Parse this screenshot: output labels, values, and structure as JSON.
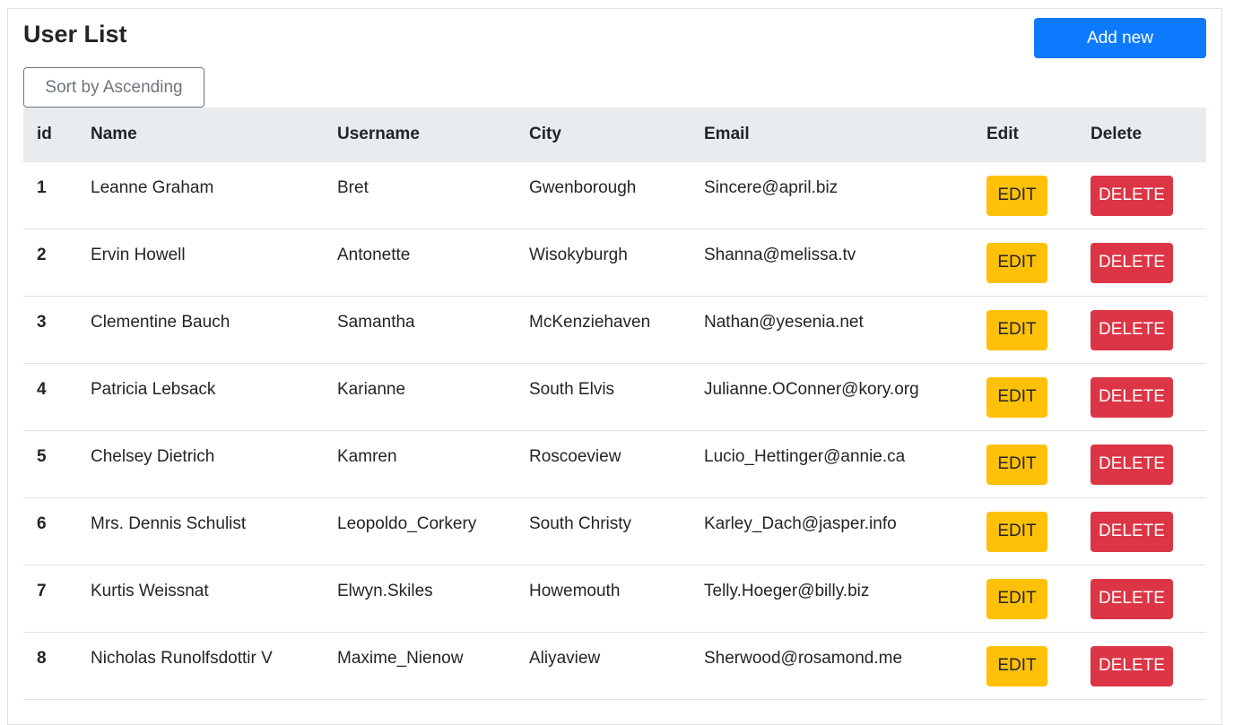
{
  "header": {
    "title": "User List",
    "add_label": "Add new",
    "sort_label": "Sort by Ascending"
  },
  "table": {
    "columns": [
      "id",
      "Name",
      "Username",
      "City",
      "Email",
      "Edit",
      "Delete"
    ],
    "edit_label": "EDIT",
    "delete_label": "DELETE",
    "rows": [
      {
        "id": "1",
        "name": "Leanne Graham",
        "username": "Bret",
        "city": "Gwenborough",
        "email": "Sincere@april.biz"
      },
      {
        "id": "2",
        "name": "Ervin Howell",
        "username": "Antonette",
        "city": "Wisokyburgh",
        "email": "Shanna@melissa.tv"
      },
      {
        "id": "3",
        "name": "Clementine Bauch",
        "username": "Samantha",
        "city": "McKenziehaven",
        "email": "Nathan@yesenia.net"
      },
      {
        "id": "4",
        "name": "Patricia Lebsack",
        "username": "Karianne",
        "city": "South Elvis",
        "email": "Julianne.OConner@kory.org"
      },
      {
        "id": "5",
        "name": "Chelsey Dietrich",
        "username": "Kamren",
        "city": "Roscoeview",
        "email": "Lucio_Hettinger@annie.ca"
      },
      {
        "id": "6",
        "name": "Mrs. Dennis Schulist",
        "username": "Leopoldo_Corkery",
        "city": "South Christy",
        "email": "Karley_Dach@jasper.info"
      },
      {
        "id": "7",
        "name": "Kurtis Weissnat",
        "username": "Elwyn.Skiles",
        "city": "Howemouth",
        "email": "Telly.Hoeger@billy.biz"
      },
      {
        "id": "8",
        "name": "Nicholas Runolfsdottir V",
        "username": "Maxime_Nienow",
        "city": "Aliyaview",
        "email": "Sherwood@rosamond.me"
      }
    ]
  },
  "colors": {
    "primary": "#0d7bff",
    "warning": "#ffc107",
    "danger": "#dc3545",
    "header_bg": "#e9ecef"
  }
}
